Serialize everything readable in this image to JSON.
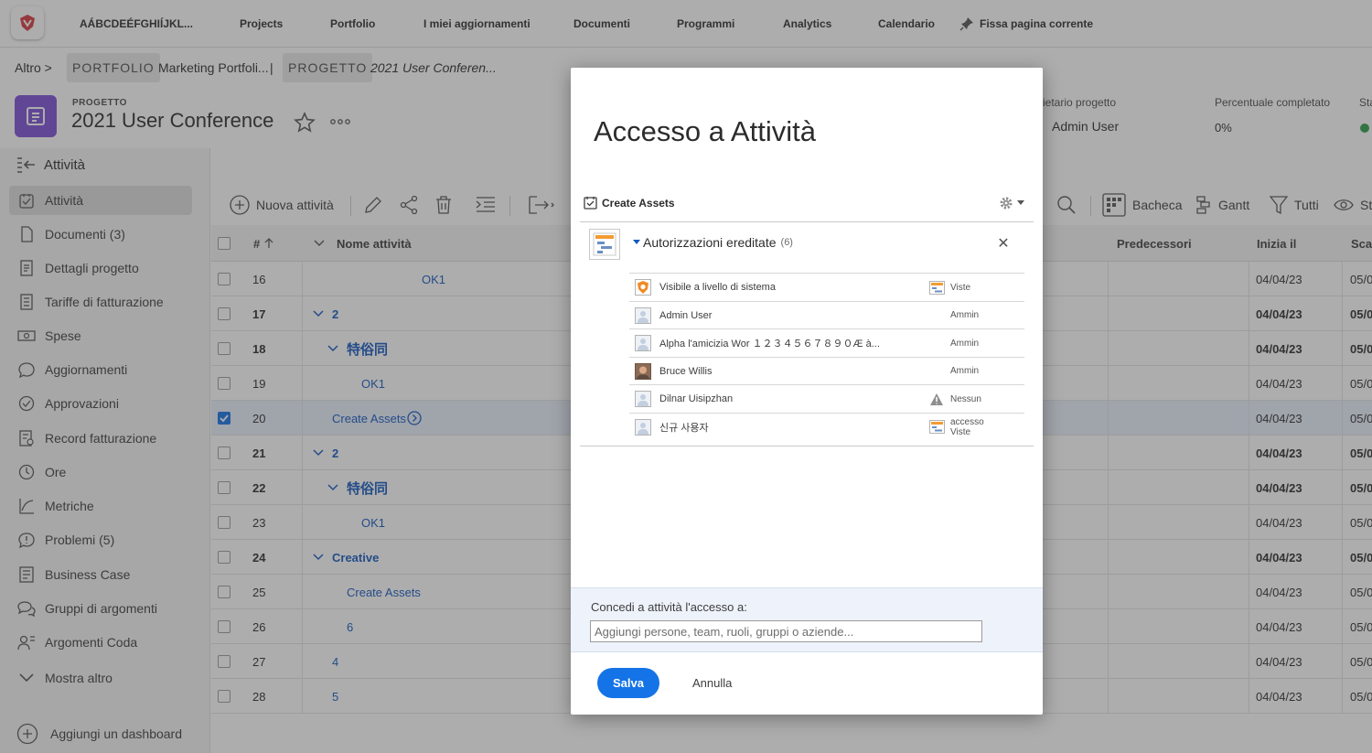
{
  "topbar": {
    "account": "AÁBCDEÉFGHIÍJKL...",
    "nav": [
      "Projects",
      "Portfolio",
      "I miei aggiornamenti",
      "Documenti",
      "Programmi",
      "Analytics",
      "Calendario"
    ],
    "pin_label": "Fissa pagina corrente"
  },
  "breadcrumb": {
    "more": "Altro",
    "portfolio_tag": "PORTFOLIO",
    "portfolio_name": "Marketing Portfoli...",
    "project_tag": "PROGETTO",
    "project_name": "2021 User Conferen..."
  },
  "project": {
    "kicker": "PROGETTO",
    "title": "2021 User Conference",
    "owner_label": "rietario progetto",
    "owner_value": "Admin User",
    "percent_label": "Percentuale completato",
    "percent_value": "0%",
    "status_label": "Sta"
  },
  "leftnav": {
    "header": "Attività",
    "items": [
      {
        "label": "Attività",
        "icon": "task-icon"
      },
      {
        "label": "Documenti (3)",
        "icon": "document-icon"
      },
      {
        "label": "Dettagli progetto",
        "icon": "details-icon"
      },
      {
        "label": "Tariffe di fatturazione",
        "icon": "billing-rates-icon"
      },
      {
        "label": "Spese",
        "icon": "expenses-icon"
      },
      {
        "label": "Aggiornamenti",
        "icon": "updates-icon"
      },
      {
        "label": "Approvazioni",
        "icon": "approvals-icon"
      },
      {
        "label": "Record fatturazione",
        "icon": "billing-record-icon"
      },
      {
        "label": "Ore",
        "icon": "hours-icon"
      },
      {
        "label": "Metriche",
        "icon": "metrics-icon"
      },
      {
        "label": "Problemi (5)",
        "icon": "issues-icon"
      },
      {
        "label": "Business Case",
        "icon": "business-case-icon"
      },
      {
        "label": "Gruppi di argomenti",
        "icon": "topic-groups-icon"
      },
      {
        "label": "Argomenti Coda",
        "icon": "queue-topics-icon"
      },
      {
        "label": "Mostra altro",
        "icon": "chevron-down-icon"
      }
    ],
    "add_dashboard": "Aggiungi un dashboard"
  },
  "toolbar": {
    "new_task": "Nuova attività",
    "board": "Bacheca",
    "gantt": "Gantt",
    "filter": "Tutti",
    "view": "Sta"
  },
  "table": {
    "headers": {
      "num": "#",
      "name": "Nome attività",
      "predecessors": "Predecessori",
      "start": "Inizia il",
      "due": "Scad"
    },
    "rows": [
      {
        "num": "16",
        "name": "OK1",
        "indent": 3,
        "expand": false,
        "bold": false,
        "start": "04/04/23",
        "due": "05/0",
        "selected": false
      },
      {
        "num": "17",
        "name": "2",
        "indent": 0,
        "expand": true,
        "bold": true,
        "start": "04/04/23",
        "due": "05/0",
        "selected": false
      },
      {
        "num": "18",
        "name": "特俗同",
        "indent": 1,
        "expand": true,
        "bold": true,
        "start": "04/04/23",
        "due": "05/0",
        "selected": false
      },
      {
        "num": "19",
        "name": "OK1",
        "indent": 2,
        "expand": false,
        "bold": false,
        "start": "04/04/23",
        "due": "05/0",
        "selected": false
      },
      {
        "num": "20",
        "name": "Create Assets",
        "indent": 0,
        "expand": false,
        "bold": false,
        "start": "04/04/23",
        "due": "05/0",
        "selected": true
      },
      {
        "num": "21",
        "name": "2",
        "indent": 0,
        "expand": true,
        "bold": true,
        "start": "04/04/23",
        "due": "05/0",
        "selected": false
      },
      {
        "num": "22",
        "name": "特俗同",
        "indent": 1,
        "expand": true,
        "bold": true,
        "start": "04/04/23",
        "due": "05/0",
        "selected": false
      },
      {
        "num": "23",
        "name": "OK1",
        "indent": 2,
        "expand": false,
        "bold": false,
        "start": "04/04/23",
        "due": "05/0",
        "selected": false
      },
      {
        "num": "24",
        "name": "Creative",
        "indent": 0,
        "expand": true,
        "bold": true,
        "start": "04/04/23",
        "due": "05/0",
        "selected": false
      },
      {
        "num": "25",
        "name": "Create Assets",
        "indent": 1,
        "expand": false,
        "bold": false,
        "start": "04/04/23",
        "due": "05/0",
        "selected": false
      },
      {
        "num": "26",
        "name": "6",
        "indent": 1,
        "expand": false,
        "bold": false,
        "start": "04/04/23",
        "due": "05/0",
        "selected": false
      },
      {
        "num": "27",
        "name": "4",
        "indent": 0,
        "expand": false,
        "bold": false,
        "start": "04/04/23",
        "due": "05/0",
        "selected": false
      },
      {
        "num": "28",
        "name": "5",
        "indent": 0,
        "expand": false,
        "bold": false,
        "start": "04/04/23",
        "due": "05/0",
        "selected": false
      }
    ]
  },
  "modal": {
    "title": "Accesso a Attività",
    "object_name": "Create Assets",
    "inherited_title": "Autorizzazioni ereditate",
    "inherited_count": "(6)",
    "permissions": [
      {
        "name": "Visibile a livello di sistema",
        "role": "Viste",
        "avatar": "system-shield-icon",
        "role_icon": "view-access-icon"
      },
      {
        "name": "Admin User",
        "role": "Ammin",
        "avatar": "user-avatar-icon",
        "role_icon": ""
      },
      {
        "name": "Alpha l'amicizia Wor １２３４５６７８９０Æ à...",
        "role": "Ammin",
        "avatar": "user-avatar-icon",
        "role_icon": ""
      },
      {
        "name": "Bruce Willis",
        "role": "Ammin",
        "avatar": "photo-avatar",
        "role_icon": ""
      },
      {
        "name": "Dilnar Uisipzhan",
        "role": "Nessun",
        "avatar": "user-avatar-icon",
        "role_icon": "warning-icon"
      },
      {
        "name": "신규 사용자",
        "role": "accesso Viste",
        "avatar": "user-avatar-icon",
        "role_icon": "view-access-icon"
      }
    ],
    "grant_label": "Concedi a attività l'accesso a:",
    "grant_placeholder": "Aggiungi persone, team, ruoli, gruppi o aziende...",
    "save": "Salva",
    "cancel": "Annulla"
  },
  "colors": {
    "accent": "#1473e6",
    "project_icon": "#7c4fd8",
    "link": "#1458c2",
    "status_green": "#2d9d4c"
  }
}
